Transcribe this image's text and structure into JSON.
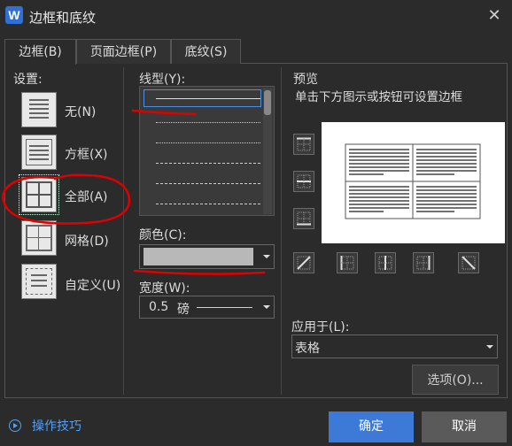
{
  "window": {
    "title": "边框和底纹",
    "app_icon_letter": "W",
    "close_glyph": "✕"
  },
  "tabs": [
    {
      "label": "边框(B)",
      "active": true
    },
    {
      "label": "页面边框(P)",
      "active": false
    },
    {
      "label": "底纹(S)",
      "active": false
    }
  ],
  "settings": {
    "label": "设置:",
    "options": [
      {
        "label": "无(N)",
        "icon": "border-none-icon"
      },
      {
        "label": "方框(X)",
        "icon": "border-box-icon"
      },
      {
        "label": "全部(A)",
        "icon": "border-all-icon",
        "selected": true
      },
      {
        "label": "网格(D)",
        "icon": "border-grid-icon"
      },
      {
        "label": "自定义(U)",
        "icon": "border-custom-icon"
      }
    ]
  },
  "line_style": {
    "label": "线型(Y):",
    "selected_index": 0
  },
  "color": {
    "label": "颜色(C):",
    "value": "#b8b8b8"
  },
  "width": {
    "label": "宽度(W):",
    "value": "0.5",
    "unit": "磅"
  },
  "preview": {
    "label": "预览",
    "hint": "单击下方图示或按钮可设置边框"
  },
  "apply_to": {
    "label": "应用于(L):",
    "value": "表格"
  },
  "buttons": {
    "options": "选项(O)...",
    "ok": "确定",
    "cancel": "取消"
  },
  "tips": {
    "label": "操作技巧"
  },
  "colors": {
    "accent": "#3d7ad8",
    "link": "#4ea1ff",
    "annotation": "#e00000"
  }
}
